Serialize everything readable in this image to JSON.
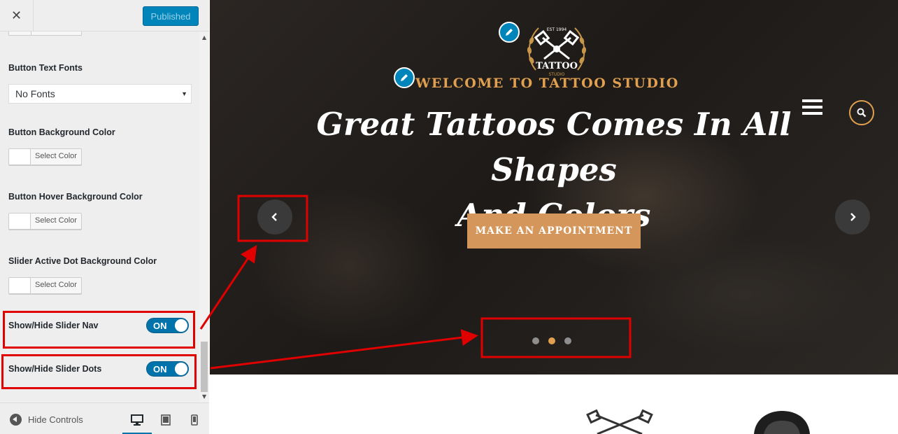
{
  "header": {
    "close_label": "✕",
    "publish_label": "Published"
  },
  "controls": {
    "button_text_fonts": {
      "label": "Button Text Fonts",
      "value": "No Fonts"
    },
    "button_background_color": {
      "label": "Button Background Color",
      "button_label": "Select Color"
    },
    "button_hover_background_color": {
      "label": "Button Hover Background Color",
      "button_label": "Select Color"
    },
    "slider_active_dot_bg_color": {
      "label": "Slider Active Dot Background Color",
      "button_label": "Select Color"
    },
    "show_hide_slider_nav": {
      "label": "Show/Hide Slider Nav",
      "toggle_label": "ON",
      "value": true
    },
    "show_hide_slider_dots": {
      "label": "Show/Hide Slider Dots",
      "toggle_label": "ON",
      "value": true
    }
  },
  "footer": {
    "hide_controls_label": "Hide Controls",
    "active_device": "desktop"
  },
  "preview": {
    "logo": {
      "top_text": "EST 1994",
      "name": "TATTOO",
      "sub": "STUDIO"
    },
    "welcome_text": "WELCOME TO TATTOO STUDIO",
    "headline_line1": "Great Tattoos Comes In All Shapes",
    "headline_line2": "And Colors",
    "cta_label": "MAKE AN APPOINTMENT",
    "slider": {
      "dot_count": 3,
      "active_dot": 2
    },
    "colors": {
      "accent": "#e0a050",
      "cta": "#d4965a",
      "annotation": "#e00000",
      "wp_blue": "#0085ba"
    }
  }
}
